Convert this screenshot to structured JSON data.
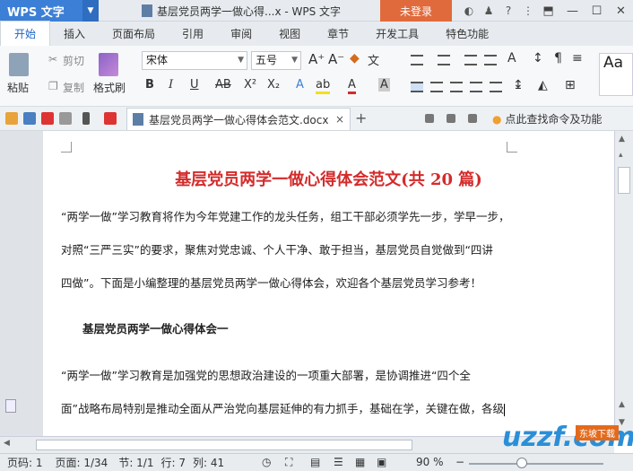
{
  "titlebar": {
    "app_name": "WPS 文字",
    "doc_title": "基层党员两学一做心得...x - WPS 文字",
    "login": "未登录"
  },
  "tabs": [
    "开始",
    "插入",
    "页面布局",
    "引用",
    "审阅",
    "视图",
    "章节",
    "开发工具",
    "特色功能"
  ],
  "ribbon": {
    "paste": "粘贴",
    "cut": "剪切",
    "copy": "复制",
    "format_painter": "格式刷",
    "font_name": "宋体",
    "font_size": "五号",
    "bold": "B",
    "italic": "I",
    "underline": "U",
    "strike": "AB",
    "style_preview": "Aa"
  },
  "doc_tab": {
    "name": "基层党员两学一做心得体会范文.docx",
    "close": "×",
    "add": "+"
  },
  "help_text": "点此查找命令及功能",
  "document": {
    "title": "基层党员两学一做心得体会范文(共 20 篇)",
    "lines": [
      "“两学一做”学习教育将作为今年党建工作的龙头任务，组工干部必须学先一步，学早一步，",
      "对照“三严三实”的要求，聚焦对党忠诚、个人干净、敢于担当，基层党员自觉做到“四讲",
      "四做”。下面是小编整理的基层党员两学一做心得体会，欢迎各个基层党员学习参考！",
      "基层党员两学一做心得体会一",
      "“两学一做”学习教育是加强党的思想政治建设的一项重大部署，是协调推进“四个全",
      "面”战略布局特别是推动全面从严治党向基层延伸的有力抓手，基础在学，关键在做，各级"
    ]
  },
  "status": {
    "page_no": "页码: 1",
    "page": "页面: 1/34",
    "section": "节: 1/1",
    "row": "行: 7",
    "col": "列: 41",
    "zoom": "90 %"
  },
  "watermark": {
    "logo": "uzzf.com",
    "badge": "东坡下载"
  },
  "colors": {
    "accent": "#3c7fd6",
    "title_red": "#d42b2b",
    "login_orange": "#e06a3c"
  }
}
